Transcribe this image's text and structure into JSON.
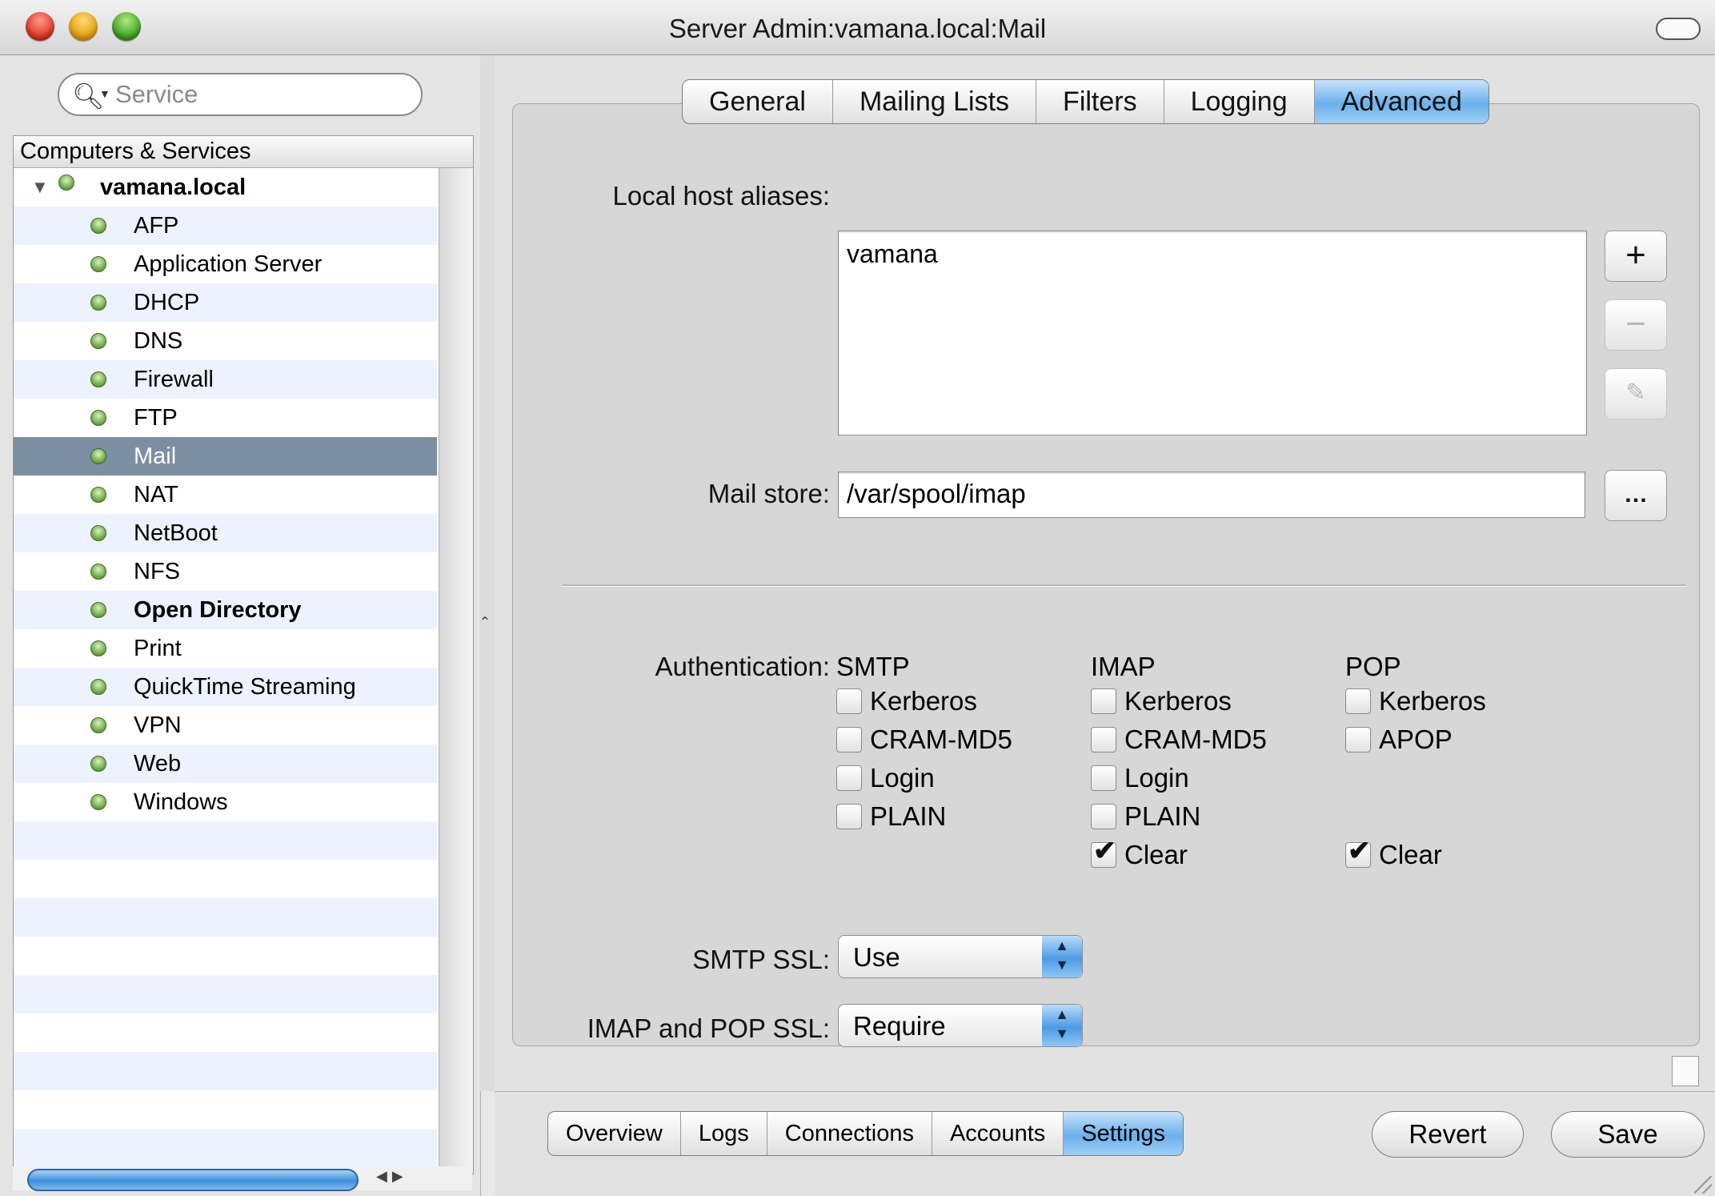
{
  "window": {
    "title": "Server Admin:vamana.local:Mail"
  },
  "sidebar": {
    "search": {
      "placeholder": "Service",
      "value": ""
    },
    "tree_header": "Computers & Services",
    "computer": "vamana.local",
    "services": [
      {
        "label": "AFP"
      },
      {
        "label": "Application Server"
      },
      {
        "label": "DHCP"
      },
      {
        "label": "DNS"
      },
      {
        "label": "Firewall"
      },
      {
        "label": "FTP"
      },
      {
        "label": "Mail",
        "selected": true
      },
      {
        "label": "NAT"
      },
      {
        "label": "NetBoot"
      },
      {
        "label": "NFS"
      },
      {
        "label": "Open Directory",
        "bold": true
      },
      {
        "label": "Print"
      },
      {
        "label": "QuickTime Streaming"
      },
      {
        "label": "VPN"
      },
      {
        "label": "Web"
      },
      {
        "label": "Windows"
      }
    ]
  },
  "tabs": [
    "General",
    "Mailing Lists",
    "Filters",
    "Logging",
    "Advanced"
  ],
  "active_tab": "Advanced",
  "advanced": {
    "aliases_label": "Local host aliases:",
    "aliases": [
      "vamana"
    ],
    "mail_store_label": "Mail store:",
    "mail_store_value": "/var/spool/imap",
    "browse_label": "…",
    "authentication_label": "Authentication:",
    "smtp_head": "SMTP",
    "imap_head": "IMAP",
    "pop_head": "POP",
    "smtp_options": [
      {
        "label": "Kerberos",
        "checked": false
      },
      {
        "label": "CRAM-MD5",
        "checked": false
      },
      {
        "label": "Login",
        "checked": false
      },
      {
        "label": "PLAIN",
        "checked": false
      }
    ],
    "imap_options": [
      {
        "label": "Kerberos",
        "checked": false
      },
      {
        "label": "CRAM-MD5",
        "checked": false
      },
      {
        "label": "Login",
        "checked": false
      },
      {
        "label": "PLAIN",
        "checked": false
      },
      {
        "label": "Clear",
        "checked": true
      }
    ],
    "pop_options": [
      {
        "label": "Kerberos",
        "checked": false
      },
      {
        "label": "APOP",
        "checked": false
      },
      {
        "label": "Clear",
        "checked": true
      }
    ],
    "smtp_ssl_label": "SMTP SSL:",
    "smtp_ssl_value": "Use",
    "imap_pop_ssl_label": "IMAP and POP SSL:",
    "imap_pop_ssl_value": "Require"
  },
  "bottom_tabs": [
    "Overview",
    "Logs",
    "Connections",
    "Accounts",
    "Settings"
  ],
  "bottom_active": "Settings",
  "buttons": {
    "revert": "Revert",
    "save": "Save"
  },
  "colors": {
    "selection": "#7c8ea2",
    "aqua_blue": "#6bb0ec",
    "row_stripe": "#edf3fe"
  }
}
